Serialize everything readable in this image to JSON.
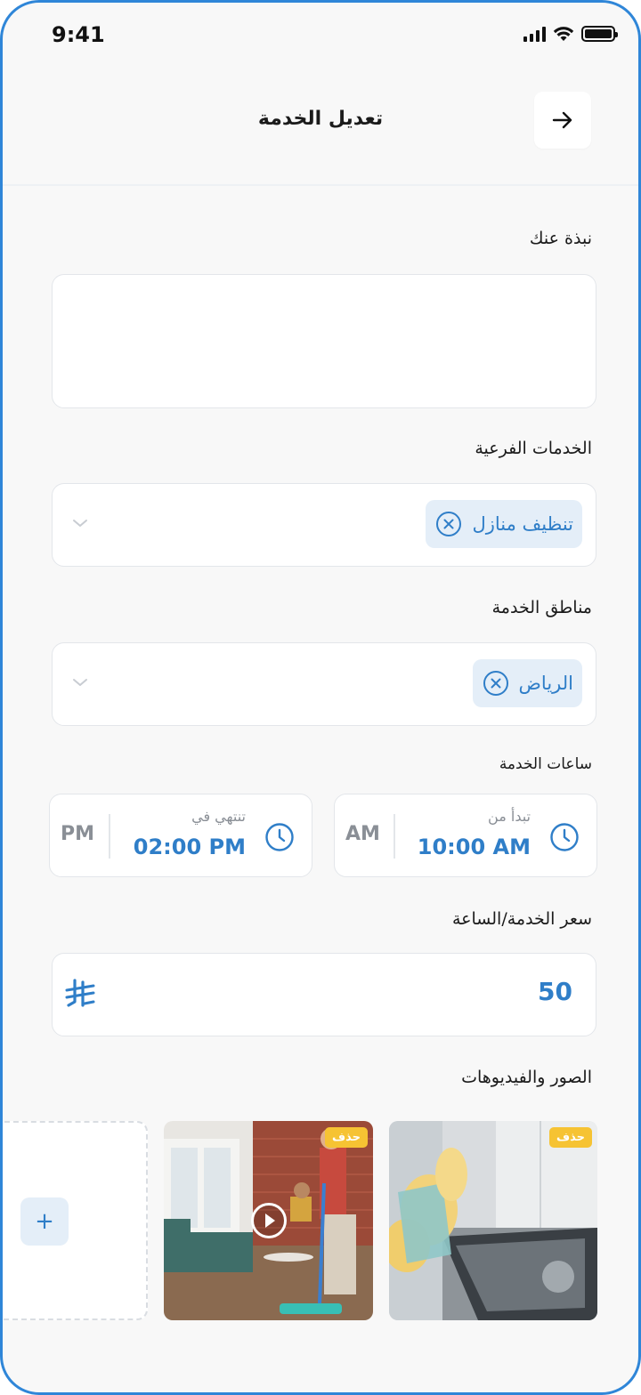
{
  "status": {
    "time": "9:41"
  },
  "header": {
    "title": "تعديل الخدمة",
    "back_icon": "arrow-right-icon"
  },
  "about": {
    "label": "نبذة عنك",
    "value": ""
  },
  "sub_services": {
    "label": "الخدمات الفرعية",
    "selected": [
      "تنظيف منازل"
    ]
  },
  "service_areas": {
    "label": "مناطق الخدمة",
    "selected": [
      "الرياض"
    ]
  },
  "service_hours": {
    "label": "ساعات الخدمة",
    "start": {
      "label": "تبدأ من",
      "value": "10:00 AM",
      "period": "AM"
    },
    "end": {
      "label": "تنتهي في",
      "value": "02:00 PM",
      "period": "PM"
    }
  },
  "price": {
    "label": "سعر الخدمة/الساعة",
    "value": "50",
    "currency_icon": "saudi-riyal-icon"
  },
  "media": {
    "label": "الصور والفيديوهات",
    "delete_label": "حذف",
    "items": [
      {
        "type": "image",
        "subject": "oven cleaning"
      },
      {
        "type": "video",
        "subject": "floor mopping"
      }
    ],
    "add_label": "+"
  },
  "colors": {
    "accent": "#2f7ec8",
    "chip_bg": "#e4eef8",
    "delete_badge": "#f6c333",
    "frame": "#2f86d8"
  }
}
